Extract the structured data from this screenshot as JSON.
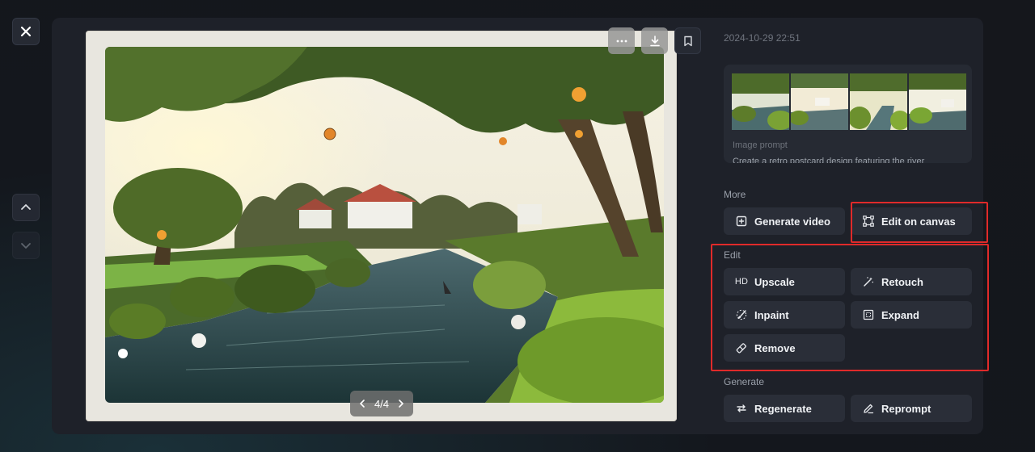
{
  "toolbar": {
    "close_icon": "close-icon",
    "more_icon": "more-horizontal-icon",
    "download_icon": "download-icon",
    "bookmark_icon": "bookmark-icon"
  },
  "navigation": {
    "up_icon": "chevron-up-icon",
    "down_icon": "chevron-down-icon"
  },
  "pager": {
    "label": "4/4",
    "prev_icon": "chevron-left-icon",
    "next_icon": "chevron-right-icon"
  },
  "details": {
    "timestamp": "2024-10-29 22:51",
    "prompt_label": "Image prompt",
    "prompt_text": "Create a retro postcard design featuring the river"
  },
  "sections": {
    "more": {
      "label": "More",
      "buttons": [
        {
          "label": "Generate video",
          "icon": "generate-video-icon"
        },
        {
          "label": "Edit on canvas",
          "icon": "canvas-icon"
        }
      ]
    },
    "edit": {
      "label": "Edit",
      "buttons": [
        {
          "label": "Upscale",
          "icon": "HD"
        },
        {
          "label": "Retouch",
          "icon": "magic-wand-icon"
        },
        {
          "label": "Inpaint",
          "icon": "brush-icon"
        },
        {
          "label": "Expand",
          "icon": "expand-icon"
        },
        {
          "label": "Remove",
          "icon": "eraser-icon"
        }
      ]
    },
    "generate": {
      "label": "Generate",
      "buttons": [
        {
          "label": "Regenerate",
          "icon": "regenerate-icon"
        },
        {
          "label": "Reprompt",
          "icon": "pencil-icon"
        }
      ]
    }
  },
  "colors": {
    "highlight": "#e02a2a",
    "button_bg": "#2a2e38",
    "panel_bg": "#1e2129"
  }
}
